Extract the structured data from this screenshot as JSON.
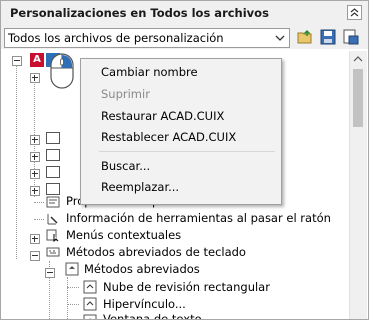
{
  "panel": {
    "title": "Personalizaciones en Todos los archivos"
  },
  "filter": {
    "value": "Todos los archivos de personalización"
  },
  "context_menu": {
    "items": [
      {
        "label": "Cambiar nombre",
        "enabled": true
      },
      {
        "label": "Suprimir",
        "enabled": false
      },
      {
        "label": "Restaurar ACAD.CUIX",
        "enabled": true
      },
      {
        "label": "Restablecer ACAD.CUIX",
        "enabled": true
      },
      {
        "label": "Buscar...",
        "enabled": true
      },
      {
        "label": "Reemplazar...",
        "enabled": true
      }
    ]
  },
  "tree": {
    "items": [
      {
        "label": "Propiedades rápidas"
      },
      {
        "label": "Información de herramientas al pasar el ratón"
      },
      {
        "label": "Menús contextuales"
      },
      {
        "label": "Métodos abreviados de teclado"
      },
      {
        "label": "Métodos abreviados"
      },
      {
        "label": "Nube de revisión rectangular"
      },
      {
        "label": "Hipervínculo..."
      },
      {
        "label": "Ventana de texto"
      }
    ]
  },
  "colors": {
    "accent_red": "#c8102e",
    "icon_blue": "#2f6fb5"
  }
}
